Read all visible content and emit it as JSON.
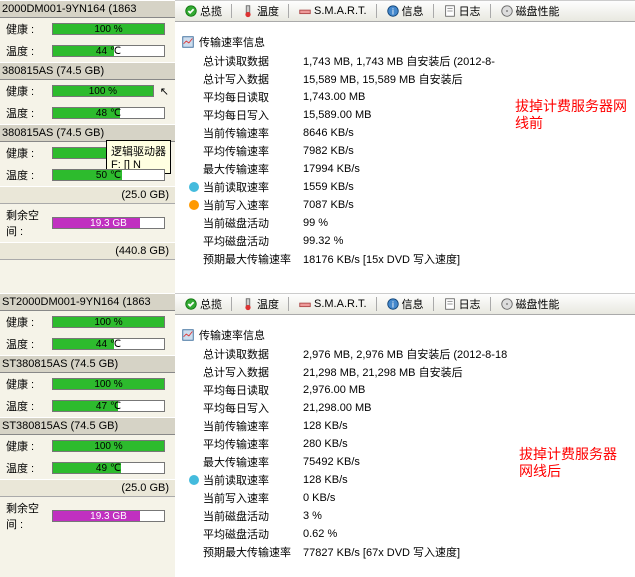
{
  "toolbar": {
    "overview": "总揽",
    "temp": "温度",
    "smart": "S.M.A.R.T.",
    "info": "信息",
    "log": "日志",
    "perf": "磁盘性能"
  },
  "infoHead": "传输速率信息",
  "labels": {
    "totalRead": "总计读取数据",
    "totalWrite": "总计写入数据",
    "avgDayRead": "平均每日读取",
    "avgDayWrite": "平均每日写入",
    "curRate": "当前传输速率",
    "avgRate": "平均传输速率",
    "maxRate": "最大传输速率",
    "curRead": "当前读取速率",
    "curWrite": "当前写入速率",
    "curAct": "当前磁盘活动",
    "avgAct": "平均磁盘活动",
    "expMax": "预期最大传输速率"
  },
  "top": {
    "totalRead": "1,743 MB, 1,743 MB 自安装后 (2012-8-",
    "totalWrite": "15,589 MB, 15,589 MB 自安装后",
    "avgDayRead": "1,743.00 MB",
    "avgDayWrite": "15,589.00 MB",
    "curRate": "8646 KB/s",
    "avgRate": "7982 KB/s",
    "maxRate": "17994 KB/s",
    "curRead": "1559 KB/s",
    "curWrite": "7087 KB/s",
    "curAct": "99 %",
    "avgAct": "99.32 %",
    "expMax": "18176 KB/s [15x DVD 写入速度]"
  },
  "bot": {
    "totalRead": "2,976 MB, 2,976 MB 自安装后 (2012-8-18",
    "totalWrite": "21,298 MB, 21,298 MB 自安装后",
    "avgDayRead": "2,976.00 MB",
    "avgDayWrite": "21,298.00 MB",
    "curRate": "128 KB/s",
    "avgRate": "280 KB/s",
    "maxRate": "75492 KB/s",
    "curRead": "128 KB/s",
    "curWrite": "0 KB/s",
    "curAct": "3 %",
    "avgAct": "0.62 %",
    "expMax": "77827 KB/s [67x DVD 写入速度]"
  },
  "anno": {
    "top1": "拔掉计费服务器网",
    "top2": "线前",
    "bot1": "拔掉计费服务器",
    "bot2": "网线后"
  },
  "side": {
    "health": "健康 :",
    "temp": "温度 :",
    "free": "剩余空间 :",
    "h100": "100 %",
    "d1": "2000DM001-9YN164 (1863",
    "d1t": "44 ℃",
    "d2": "380815AS (74.5 GB)",
    "d2t": "48 ℃",
    "d3": "380815AS (74.5 GB)",
    "d3t": "50 ℃",
    "sz1": "(25.0 GB)",
    "free1": "19.3 GB",
    "sz2": "(440.8 GB)",
    "bd1": "ST2000DM001-9YN164 (1863",
    "bd1t": "44 ℃",
    "bd2": "ST380815AS (74.5 GB)",
    "bd2t": "47 ℃",
    "bd3": "ST380815AS (74.5 GB)",
    "bd3t": "49 ℃",
    "bsz1": "(25.0 GB)",
    "bfree1": "19.3 GB",
    "tip": "逻辑驱动器",
    "tipF": "F: [] N"
  }
}
